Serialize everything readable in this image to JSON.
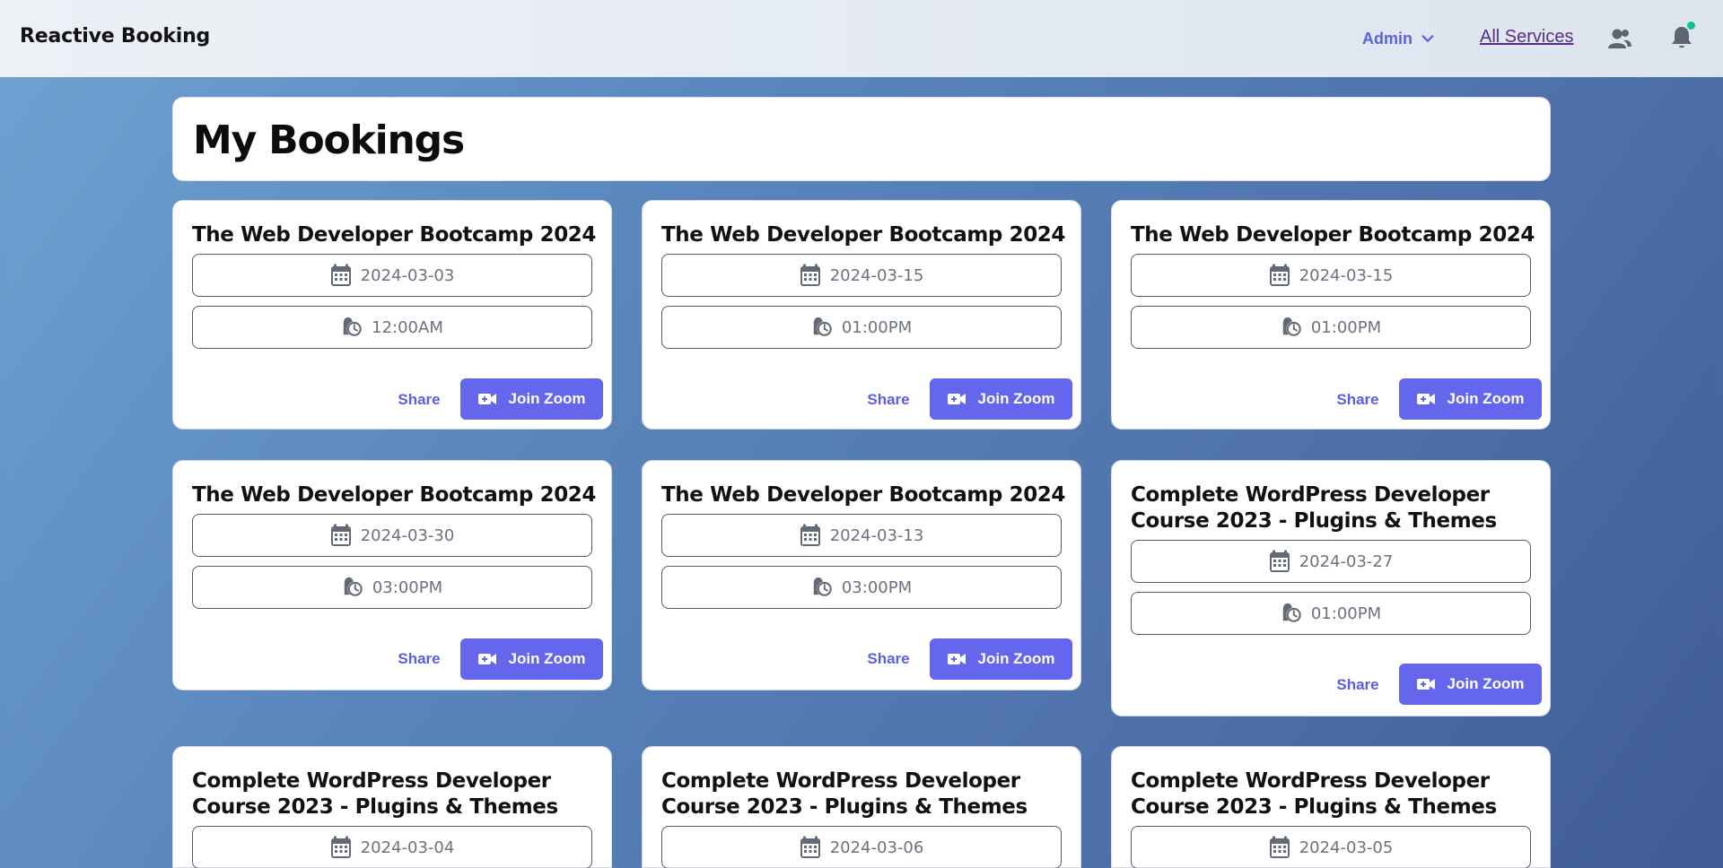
{
  "app": {
    "title": "Reactive Booking"
  },
  "nav": {
    "admin_label": "Admin",
    "services_label": "All Services",
    "users_icon": "users-icon",
    "bell_icon": "bell-icon",
    "notification_dot_color": "#13c28a"
  },
  "page": {
    "title": "My Bookings"
  },
  "colors": {
    "accent": "#6466ec",
    "link": "#5b5fe0"
  },
  "bookings": [
    {
      "title": "The Web Developer Bootcamp 2024",
      "date": "2024-03-03",
      "time": "12:00AM",
      "share_label": "Share",
      "zoom_label": "Join Zoom"
    },
    {
      "title": "The Web Developer Bootcamp 2024",
      "date": "2024-03-15",
      "time": "01:00PM",
      "share_label": "Share",
      "zoom_label": "Join Zoom"
    },
    {
      "title": "The Web Developer Bootcamp 2024",
      "date": "2024-03-15",
      "time": "01:00PM",
      "share_label": "Share",
      "zoom_label": "Join Zoom"
    },
    {
      "title": "The Web Developer Bootcamp 2024",
      "date": "2024-03-30",
      "time": "03:00PM",
      "share_label": "Share",
      "zoom_label": "Join Zoom"
    },
    {
      "title": "The Web Developer Bootcamp 2024",
      "date": "2024-03-13",
      "time": "03:00PM",
      "share_label": "Share",
      "zoom_label": "Join Zoom"
    },
    {
      "title": "Complete WordPress Developer Course 2023 - Plugins & Themes",
      "date": "2024-03-27",
      "time": "01:00PM",
      "share_label": "Share",
      "zoom_label": "Join Zoom"
    },
    {
      "title": "Complete WordPress Developer Course 2023 - Plugins & Themes",
      "date": "2024-03-04"
    },
    {
      "title": "Complete WordPress Developer Course 2023 - Plugins & Themes",
      "date": "2024-03-06"
    },
    {
      "title": "Complete WordPress Developer Course 2023 - Plugins & Themes",
      "date": "2024-03-05"
    }
  ]
}
